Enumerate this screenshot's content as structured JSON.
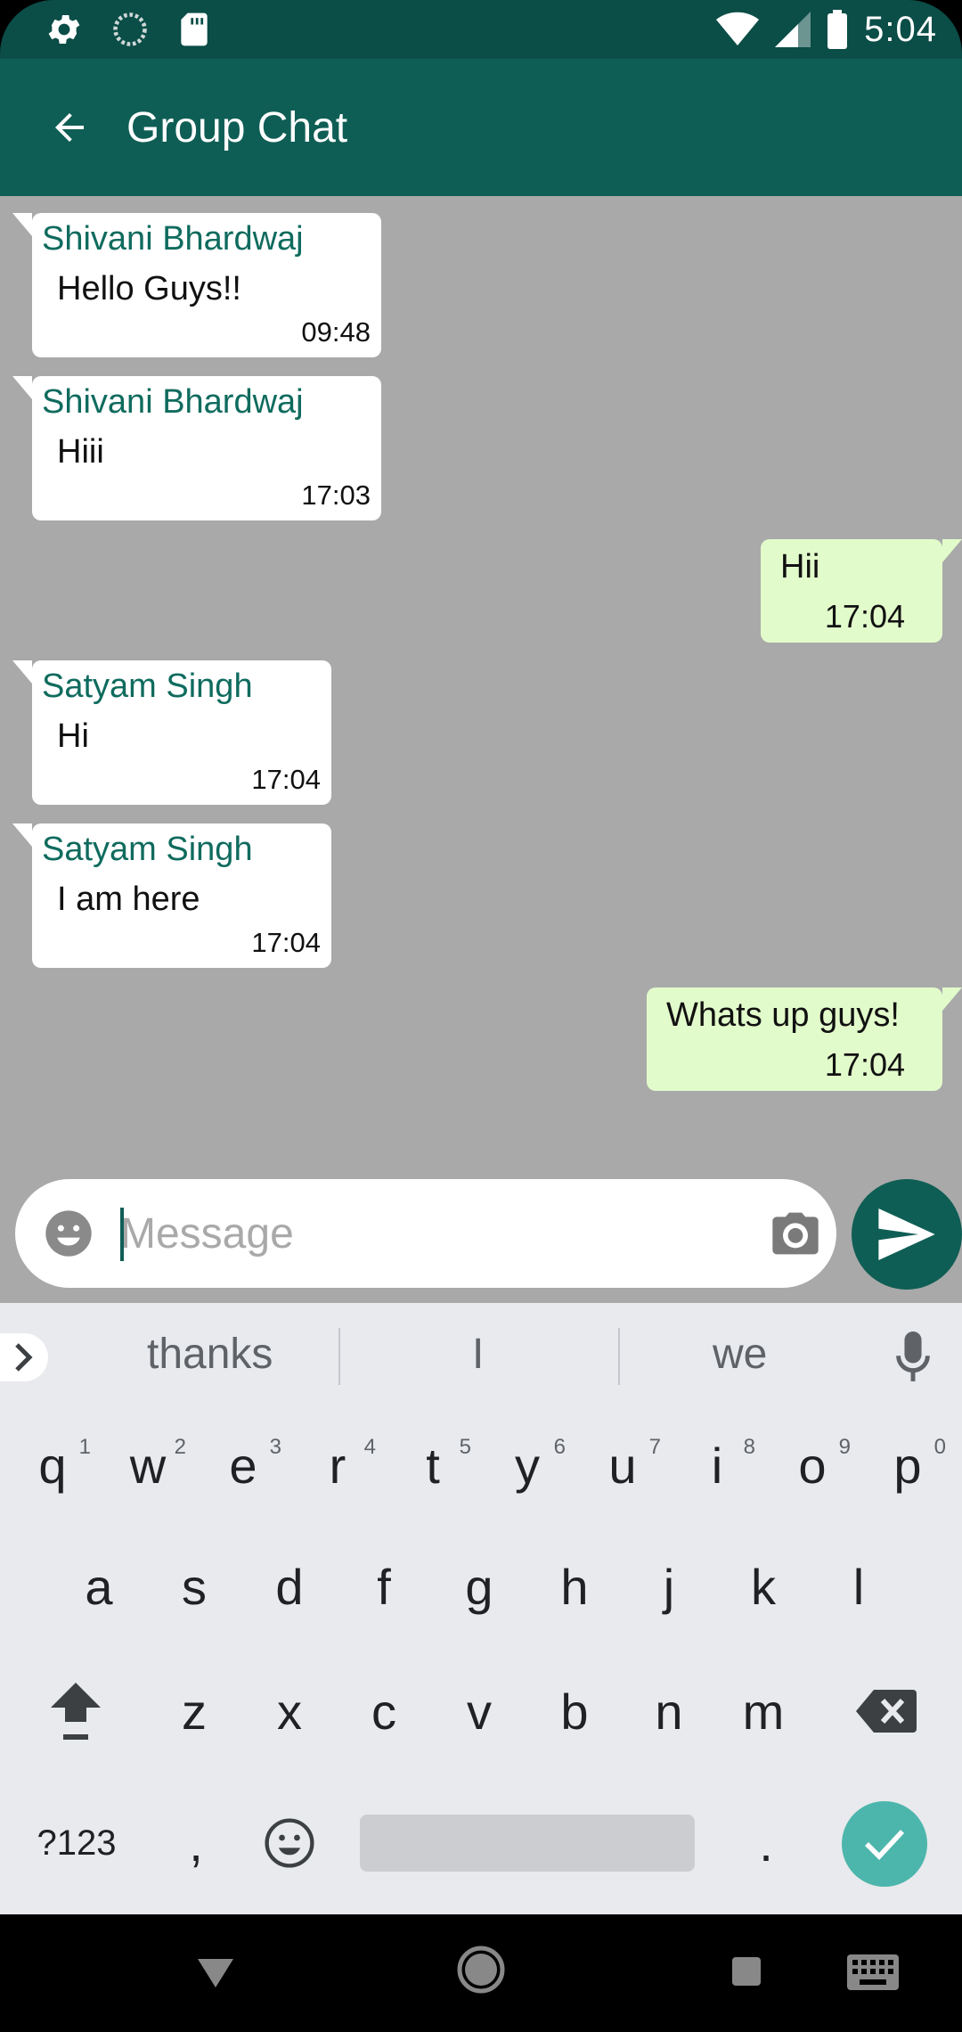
{
  "status_bar": {
    "time": "5:04",
    "icons": [
      "settings-icon",
      "sync-icon",
      "sd-card-icon",
      "wifi-icon",
      "signal-icon",
      "battery-icon"
    ]
  },
  "app_bar": {
    "title": "Group Chat",
    "back_icon": "arrow-back-icon",
    "color": "#0f5e55"
  },
  "messages": [
    {
      "direction": "in",
      "sender": "Shivani Bhardwaj",
      "text": "Hello Guys!!",
      "time": "09:48"
    },
    {
      "direction": "in",
      "sender": "Shivani Bhardwaj",
      "text": "Hiii",
      "time": "17:03"
    },
    {
      "direction": "out",
      "sender": "",
      "text": "Hii",
      "time": "17:04"
    },
    {
      "direction": "in",
      "sender": "Satyam Singh",
      "text": "Hi",
      "time": "17:04"
    },
    {
      "direction": "in",
      "sender": "Satyam Singh",
      "text": "I am here",
      "time": "17:04"
    },
    {
      "direction": "out",
      "sender": "",
      "text": "Whats up guys!",
      "time": "17:04"
    }
  ],
  "composer": {
    "placeholder": "Message",
    "value": "",
    "emoji_icon": "emoji-icon",
    "camera_icon": "camera-icon",
    "send_icon": "send-icon"
  },
  "keyboard": {
    "suggestions": [
      "thanks",
      "I",
      "we"
    ],
    "rows": [
      [
        "q",
        "w",
        "e",
        "r",
        "t",
        "y",
        "u",
        "i",
        "o",
        "p"
      ],
      [
        "a",
        "s",
        "d",
        "f",
        "g",
        "h",
        "j",
        "k",
        "l"
      ],
      [
        "z",
        "x",
        "c",
        "v",
        "b",
        "n",
        "m"
      ]
    ],
    "number_hints": [
      "1",
      "2",
      "3",
      "4",
      "5",
      "6",
      "7",
      "8",
      "9",
      "0"
    ],
    "symbols_label": "?123",
    "comma_label": ",",
    "period_label": ".",
    "enter_icon": "check-icon",
    "accent": "#4db6ac"
  },
  "nav_bar": {
    "icons": [
      "back-triangle-icon",
      "home-circle-icon",
      "recents-square-icon",
      "keyboard-switch-icon"
    ]
  }
}
